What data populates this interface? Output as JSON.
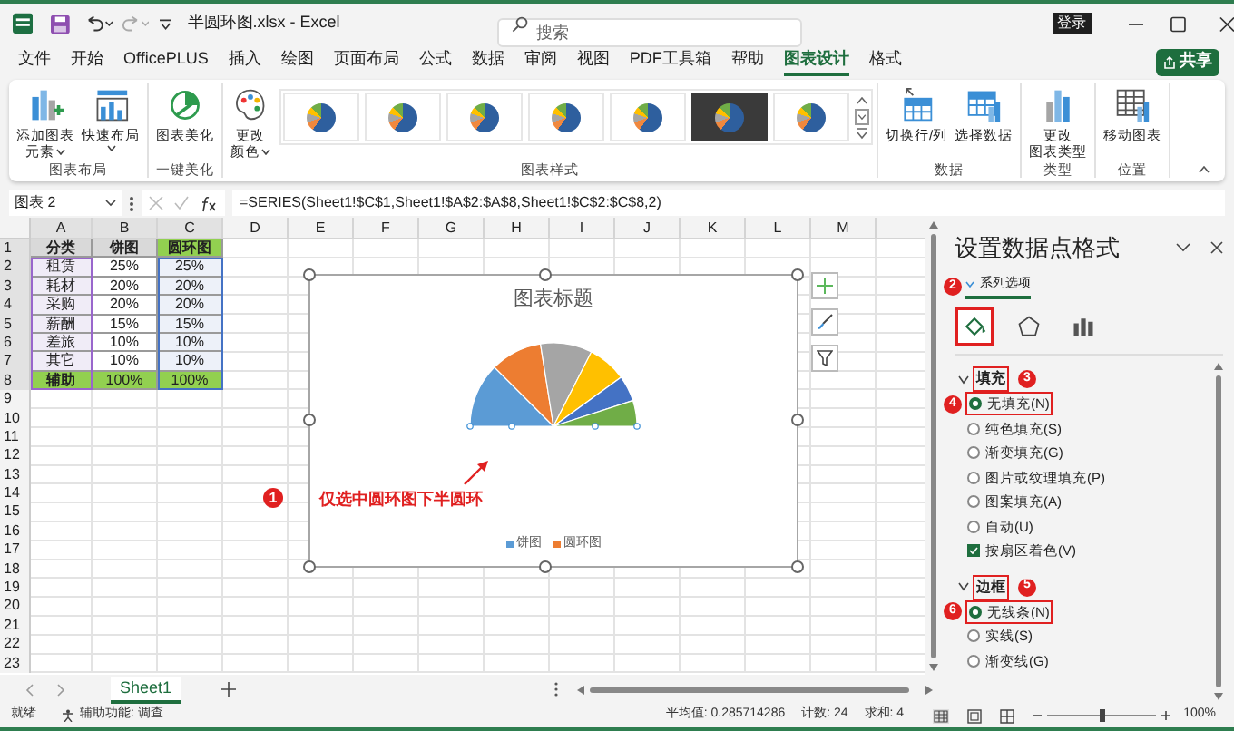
{
  "title_bar": {
    "title": "半圆环图.xlsx - Excel",
    "search": {
      "placeholder": "搜索"
    },
    "login_button": "登录"
  },
  "menu_tabs": [
    {
      "label": "文件",
      "selected": false
    },
    {
      "label": "开始",
      "selected": false
    },
    {
      "label": "OfficePLUS",
      "selected": false
    },
    {
      "label": "插入",
      "selected": false
    },
    {
      "label": "绘图",
      "selected": false
    },
    {
      "label": "页面布局",
      "selected": false
    },
    {
      "label": "公式",
      "selected": false
    },
    {
      "label": "数据",
      "selected": false
    },
    {
      "label": "审阅",
      "selected": false
    },
    {
      "label": "视图",
      "selected": false
    },
    {
      "label": "PDF工具箱",
      "selected": false
    },
    {
      "label": "帮助",
      "selected": false
    },
    {
      "label": "图表设计",
      "selected": true
    },
    {
      "label": "格式",
      "selected": false
    }
  ],
  "share_button": "共享",
  "ribbon": {
    "groups": [
      {
        "label": "图表布局",
        "buttons": [
          {
            "kind": "add-element",
            "lines": [
              "添加图表",
              "元素"
            ],
            "dropdown": true
          },
          {
            "kind": "quick-layout",
            "lines": [
              "快速布局"
            ],
            "dropdown": true
          }
        ]
      },
      {
        "label": "一键美化",
        "buttons": [
          {
            "kind": "beautify",
            "lines": [
              "图表美化"
            ],
            "dropdown": false
          }
        ]
      },
      {
        "label": "图表样式",
        "buttons": [
          {
            "kind": "colors",
            "lines": [
              "更改",
              "颜色"
            ],
            "dropdown": true
          }
        ],
        "styles": [
          {
            "selected": false
          },
          {
            "selected": false
          },
          {
            "selected": false
          },
          {
            "selected": false
          },
          {
            "selected": false
          },
          {
            "selected": true
          },
          {
            "selected": false
          }
        ]
      },
      {
        "label": "数据",
        "buttons": [
          {
            "kind": "switch",
            "lines": [
              "切换行/列"
            ],
            "dropdown": false
          },
          {
            "kind": "select-data",
            "lines": [
              "选择数据"
            ],
            "dropdown": false
          }
        ]
      },
      {
        "label": "类型",
        "buttons": [
          {
            "kind": "change-type",
            "lines": [
              "更改",
              "图表类型"
            ],
            "dropdown": false
          }
        ]
      },
      {
        "label": "位置",
        "buttons": [
          {
            "kind": "move",
            "lines": [
              "移动图表"
            ],
            "dropdown": false
          }
        ]
      }
    ]
  },
  "formula_bar": {
    "name_box": "图表 2",
    "formula": "=SERIES(Sheet1!$C$1,Sheet1!$A$2:$A$8,Sheet1!$C$2:$C$8,2)"
  },
  "sheet": {
    "columns": [
      {
        "label": "A",
        "color": "#9966cc"
      },
      {
        "label": "B"
      },
      {
        "label": "C",
        "color": "#4472c4"
      },
      {
        "label": "D"
      },
      {
        "label": "E"
      },
      {
        "label": "F"
      },
      {
        "label": "G"
      },
      {
        "label": "H"
      },
      {
        "label": "I"
      },
      {
        "label": "J"
      },
      {
        "label": "K"
      },
      {
        "label": "L"
      },
      {
        "label": "M"
      }
    ],
    "row_numbers": [
      "1",
      "2",
      "3",
      "4",
      "5",
      "6",
      "7",
      "8",
      "9",
      "10",
      "11",
      "12",
      "13",
      "14",
      "15",
      "16",
      "17",
      "18",
      "19",
      "20",
      "21",
      "22",
      "23"
    ],
    "rows": [
      {
        "kind": "header",
        "cells": [
          "分类",
          "饼图",
          "圆环图"
        ]
      },
      {
        "kind": "body",
        "cells": [
          "租赁",
          "25%",
          "25%"
        ]
      },
      {
        "kind": "body",
        "cells": [
          "耗材",
          "20%",
          "20%"
        ]
      },
      {
        "kind": "body",
        "cells": [
          "采购",
          "20%",
          "20%"
        ]
      },
      {
        "kind": "body",
        "cells": [
          "薪酬",
          "15%",
          "15%"
        ]
      },
      {
        "kind": "body",
        "cells": [
          "差旅",
          "10%",
          "10%"
        ]
      },
      {
        "kind": "body",
        "cells": [
          "其它",
          "10%",
          "10%"
        ]
      },
      {
        "kind": "total",
        "cells": [
          "辅助",
          "100%",
          "100%"
        ]
      }
    ]
  },
  "chart": {
    "title": "图表标题",
    "legend": [
      {
        "label": "饼图",
        "color": "#5b9bd5"
      },
      {
        "label": "圆环图",
        "color": "#ed7d31"
      }
    ]
  },
  "callout": {
    "badge": "1",
    "text": "仅选中圆环图下半圆环"
  },
  "format_panel": {
    "title": "设置数据点格式",
    "tab": "系列选项",
    "tab_badge": "2",
    "icon_tabs": [
      {
        "kind": "fill",
        "selected": true
      },
      {
        "kind": "effects",
        "selected": false
      },
      {
        "kind": "series",
        "selected": false
      }
    ],
    "sections": [
      {
        "label": "填充",
        "badge": "3",
        "expanded": true,
        "options": [
          {
            "kind": "radio",
            "label": "无填充(N)",
            "selected": true,
            "badge": "4"
          },
          {
            "kind": "radio",
            "label": "纯色填充(S)",
            "selected": false
          },
          {
            "kind": "radio",
            "label": "渐变填充(G)",
            "selected": false
          },
          {
            "kind": "radio",
            "label": "图片或纹理填充(P)",
            "selected": false
          },
          {
            "kind": "radio",
            "label": "图案填充(A)",
            "selected": false
          },
          {
            "kind": "radio",
            "label": "自动(U)",
            "selected": false
          },
          {
            "kind": "checkbox",
            "label": "按扇区着色(V)",
            "checked": true
          }
        ]
      },
      {
        "label": "边框",
        "badge": "5",
        "expanded": true,
        "options": [
          {
            "kind": "radio",
            "label": "无线条(N)",
            "selected": true,
            "badge": "6"
          },
          {
            "kind": "radio",
            "label": "实线(S)",
            "selected": false
          },
          {
            "kind": "radio",
            "label": "渐变线(G)",
            "selected": false
          }
        ]
      }
    ]
  },
  "sheet_tabs": [
    {
      "label": "Sheet1",
      "selected": true
    }
  ],
  "status_bar": {
    "ready": "就绪",
    "accessibility": "辅助功能: 调查",
    "average": "平均值: 0.285714286",
    "count": "计数: 24",
    "sum": "求和: 4",
    "zoom": {
      "level": 0.5
    },
    "zoom_percent": "100%"
  }
}
